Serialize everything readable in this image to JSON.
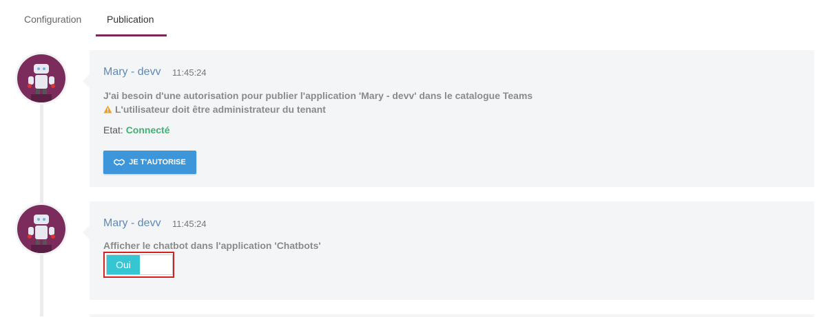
{
  "tabs": [
    {
      "label": "Configuration",
      "active": false
    },
    {
      "label": "Publication",
      "active": true
    }
  ],
  "colors": {
    "accent": "#7a2a5a",
    "author": "#5f88b5",
    "connected": "#3cb371",
    "button": "#3c96d9",
    "toggle_on": "#36c6d3",
    "highlight_border": "#d62020"
  },
  "messages": [
    {
      "author": "Mary - devv",
      "time": "11:45:24",
      "line1": "J'ai besoin d'une autorisation pour publier l'application 'Mary - devv' dans le catalogue Teams",
      "warning_icon": "warning-triangle-icon",
      "line2": "L'utilisateur doit être administrateur du tenant",
      "state_label": "Etat:",
      "state_value": "Connecté",
      "button_icon": "handshake-icon",
      "button_label": "JE T'AUTORISE"
    },
    {
      "author": "Mary - devv",
      "time": "11:45:24",
      "line1": "Afficher le chatbot dans l'application 'Chatbots'",
      "toggle_label": "Oui",
      "toggle_on": true
    }
  ]
}
